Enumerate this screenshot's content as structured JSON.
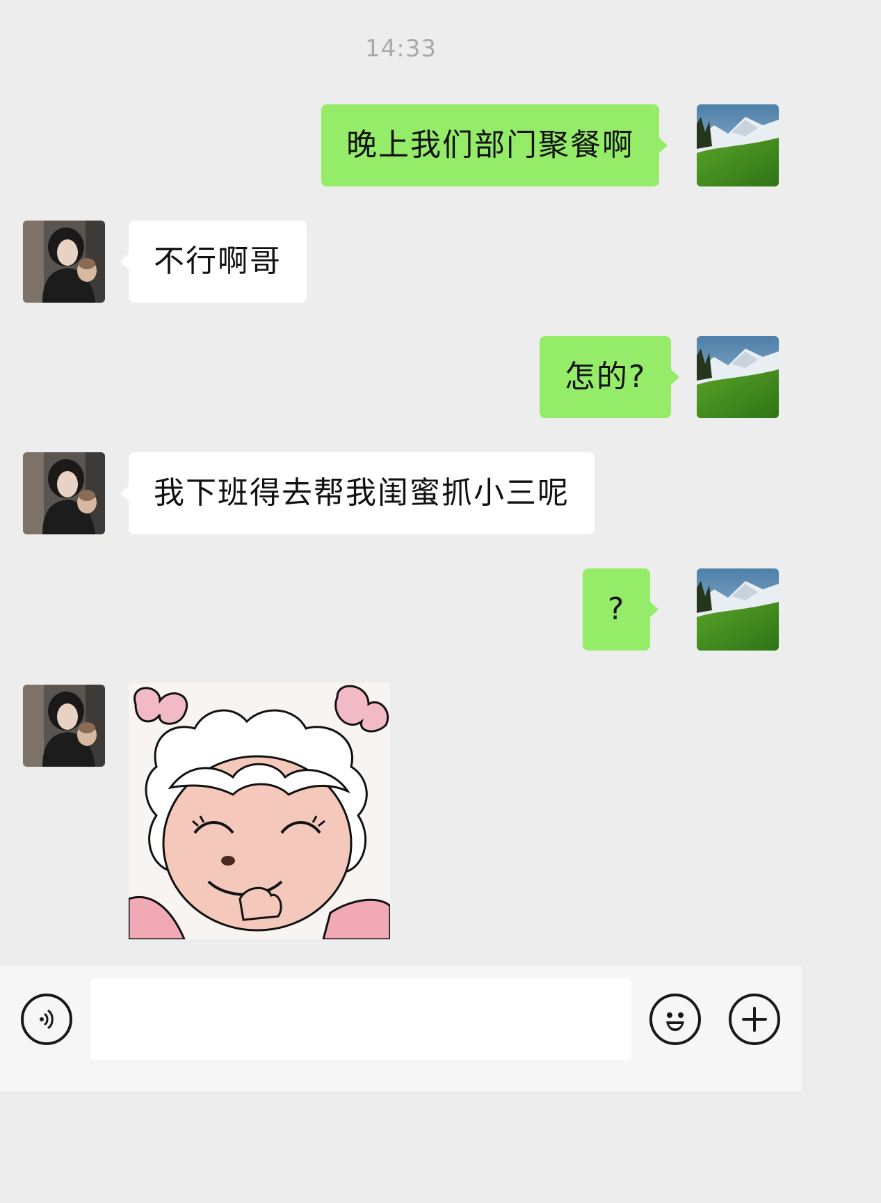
{
  "chat": {
    "timestamp": "14:33",
    "messages": [
      {
        "sender": "me",
        "text": "晚上我们部门聚餐啊"
      },
      {
        "sender": "friend",
        "text": "不行啊哥"
      },
      {
        "sender": "me",
        "text": "怎的?"
      },
      {
        "sender": "friend",
        "text": "我下班得去帮我闺蜜抓小三呢"
      },
      {
        "sender": "me",
        "text": "?"
      },
      {
        "sender": "friend",
        "type": "sticker",
        "icon": "pleasant-goat-sheep-sticker"
      }
    ]
  },
  "avatars": {
    "me": "mountain-landscape-avatar",
    "friend": "woman-with-baby-avatar"
  },
  "input_bar": {
    "placeholder": "",
    "voice_icon": "voice-icon",
    "emoji_icon": "emoji-icon",
    "plus_icon": "plus-icon"
  },
  "colors": {
    "background": "#ededed",
    "my_bubble": "#95ec69",
    "friend_bubble": "#ffffff",
    "timestamp_text": "#a9a9a9",
    "input_bar": "#f6f6f6"
  }
}
